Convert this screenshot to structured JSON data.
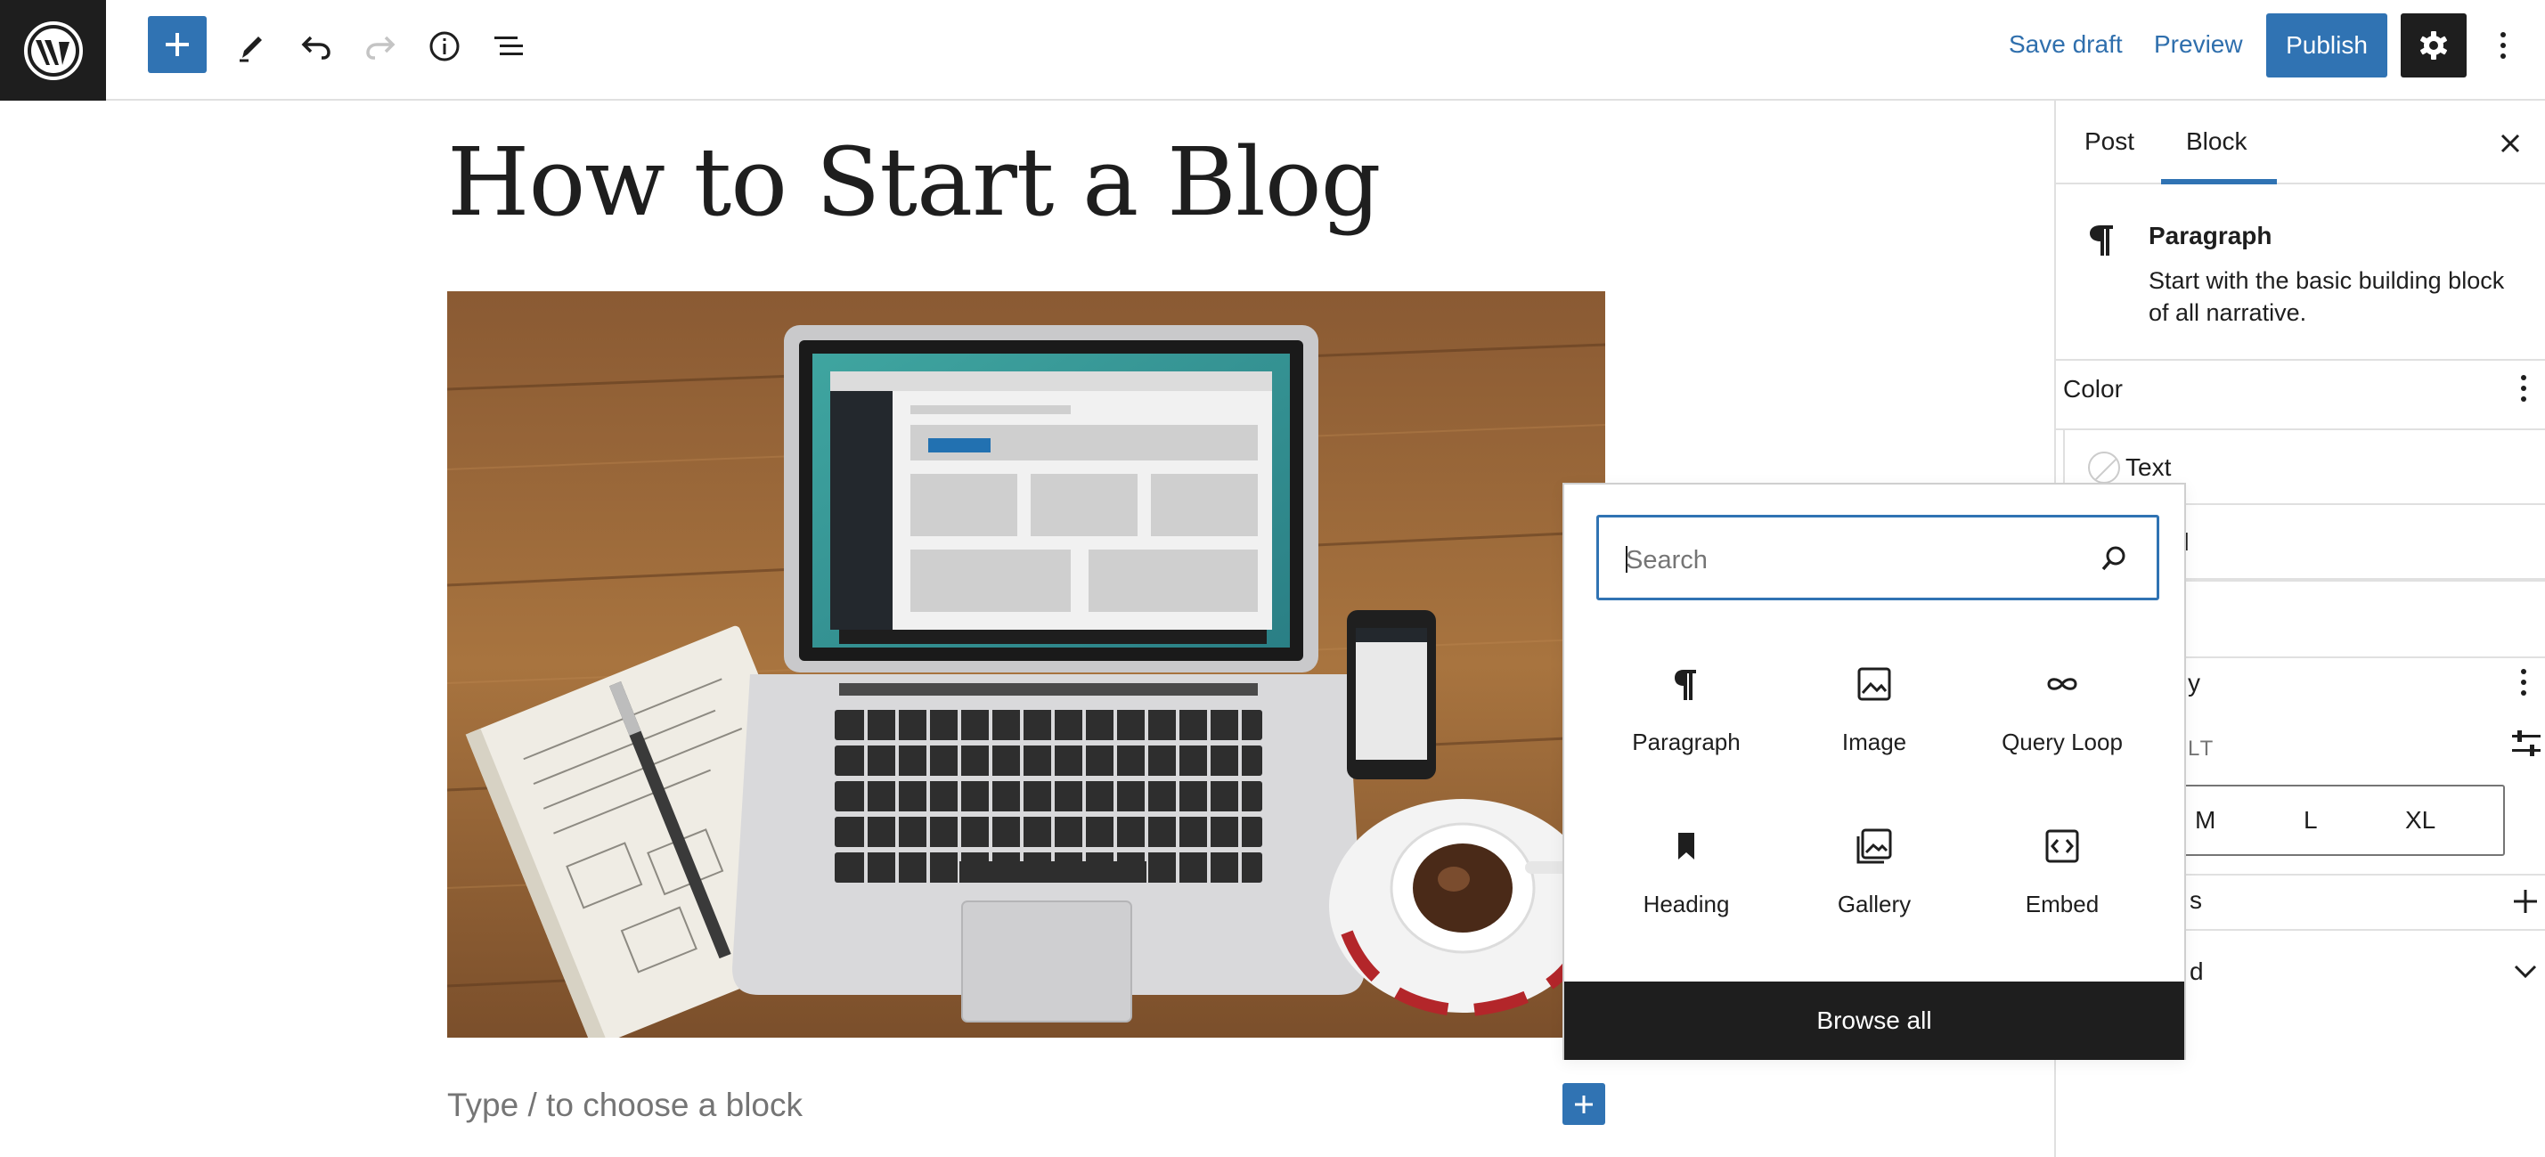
{
  "topbar": {
    "save_draft": "Save draft",
    "preview": "Preview",
    "publish": "Publish"
  },
  "editor": {
    "title": "How to Start a Blog",
    "placeholder": "Type / to choose a block"
  },
  "sidebar": {
    "tabs": [
      "Post",
      "Block"
    ],
    "active_tab": "Block",
    "block": {
      "name": "Paragraph",
      "description": "Start with the basic building block of all narrative."
    },
    "color": {
      "title": "Color",
      "items": [
        "Text",
        "round"
      ]
    },
    "typography": {
      "title_partial": "y",
      "size_label_partial": "LT",
      "sizes": [
        "M",
        "L",
        "XL"
      ]
    },
    "dimensions_partial": "s",
    "advanced_partial": "d"
  },
  "inserter": {
    "search_placeholder": "Search",
    "blocks": [
      {
        "label": "Paragraph",
        "icon": "paragraph-icon"
      },
      {
        "label": "Image",
        "icon": "image-icon"
      },
      {
        "label": "Query Loop",
        "icon": "query-loop-icon"
      },
      {
        "label": "Heading",
        "icon": "heading-icon"
      },
      {
        "label": "Gallery",
        "icon": "gallery-icon"
      },
      {
        "label": "Embed",
        "icon": "embed-icon"
      }
    ],
    "browse_all": "Browse all"
  },
  "colors": {
    "accent": "#3073b3",
    "dark": "#1e1e1e",
    "link": "#2f6fad"
  }
}
